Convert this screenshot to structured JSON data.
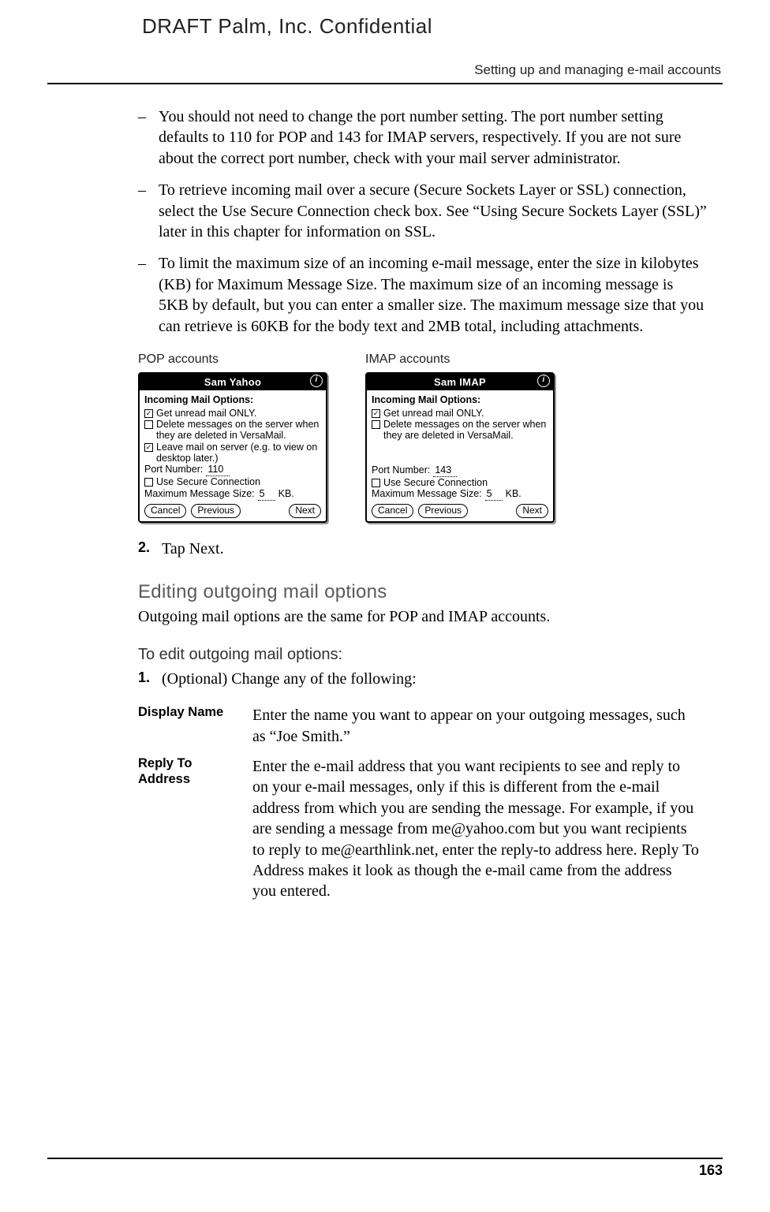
{
  "header": {
    "draft": "DRAFT   Palm, Inc. Confidential",
    "running": "Setting up and managing e-mail accounts"
  },
  "bullets": {
    "b1_a": "You should not need to change the port number setting. The port number setting defaults to 110 for POP and 143 for IMAP servers, respectively. If you are not sure about the correct port number, check with your mail server administrator.",
    "b2_a": "To retrieve incoming mail over a secure (Secure Sockets Layer or SSL) connection, select the Use Secure Connection check box. See “",
    "b2_link": "Using Secure Sockets Layer (SSL)",
    "b2_c": "” later in this chapter for information on SSL.",
    "b3": "To limit the maximum size of an incoming e-mail message, enter the size in kilobytes (KB) for Maximum Message Size. The maximum size of an incoming message is 5KB by default, but you can enter a smaller size. The maximum message size that you can retrieve is 60KB for the body text and 2MB total, including attachments."
  },
  "shots_labels": {
    "pop": "POP accounts",
    "imap": "IMAP accounts"
  },
  "dialogA": {
    "title": "Sam Yahoo",
    "section": "Incoming Mail Options:",
    "opt1": "Get unread mail ONLY.",
    "opt2": "Delete messages on the server when they are deleted in VersaMail.",
    "opt3": "Leave mail on server (e.g. to view on desktop later.)",
    "port_label": "Port Number:",
    "port": "110",
    "secure": "Use Secure Connection",
    "max_label": "Maximum Message Size:",
    "max": "5",
    "kb": "KB.",
    "cancel": "Cancel",
    "prev": "Previous",
    "next": "Next"
  },
  "dialogB": {
    "title": "Sam IMAP",
    "section": "Incoming Mail Options:",
    "opt1": "Get unread mail ONLY.",
    "opt2": "Delete messages on the server when they are deleted in VersaMail.",
    "port_label": "Port Number:",
    "port": "143",
    "secure": "Use Secure Connection",
    "max_label": "Maximum Message Size:",
    "max": "5",
    "kb": "KB.",
    "cancel": "Cancel",
    "prev": "Previous",
    "next": "Next"
  },
  "steps": {
    "s2_num": "2.",
    "s2": "Tap Next.",
    "s1_num": "1.",
    "s1": "(Optional) Change any of the following:"
  },
  "headings": {
    "editing": "Editing outgoing mail options",
    "editing_sub": "Outgoing mail options are the same for POP and IMAP accounts.",
    "toedit": "To edit outgoing mail options:"
  },
  "defs": {
    "display_name_term": "Display Name",
    "display_name_def": "Enter the name you want to appear on your outgoing messages, such as “Joe Smith.”",
    "reply_term": "Reply To Address",
    "reply_def": "Enter the e-mail address that you want recipients to see and reply to on your e-mail messages, only if this is different from the e-mail address from which you are sending the message. For example, if you are sending a message from me@yahoo.com but you want recipients to reply to me@earthlink.net, enter the reply-to address here. Reply To Address makes it look as though the e-mail came from the address you entered."
  },
  "footer": {
    "page": "163"
  }
}
